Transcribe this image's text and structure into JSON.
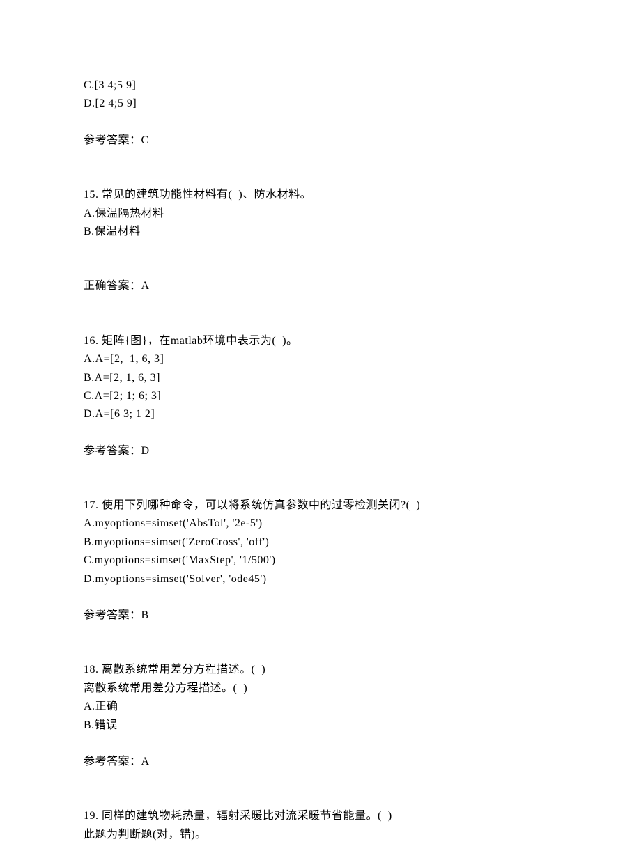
{
  "q14_partial": {
    "option_c": "C.[3 4;5 9]",
    "option_d": "D.[2 4;5 9]",
    "answer_label": "参考答案：C"
  },
  "q15": {
    "stem": "15. 常见的建筑功能性材料有(  )、防水材料。",
    "option_a": "A.保温隔热材料",
    "option_b": "B.保温材料",
    "answer_label": "正确答案：A"
  },
  "q16": {
    "stem": "16. 矩阵{图}，在matlab环境中表示为(  )。",
    "option_a": "A.A=[2,  1, 6, 3]",
    "option_b": "B.A=[2, 1, 6, 3]",
    "option_c": "C.A=[2; 1; 6; 3]",
    "option_d": "D.A=[6 3; 1 2]",
    "answer_label": "参考答案：D"
  },
  "q17": {
    "stem": "17. 使用下列哪种命令，可以将系统仿真参数中的过零检测关闭?(  )",
    "option_a": "A.myoptions=simset('AbsTol', '2e-5')",
    "option_b": "B.myoptions=simset('ZeroCross', 'off')",
    "option_c": "C.myoptions=simset('MaxStep', '1/500')",
    "option_d": "D.myoptions=simset('Solver', 'ode45')",
    "answer_label": "参考答案：B"
  },
  "q18": {
    "stem": "18. 离散系统常用差分方程描述。(  )",
    "stem_repeat": "离散系统常用差分方程描述。(  )",
    "option_a": "A.正确",
    "option_b": "B.错误",
    "answer_label": "参考答案：A"
  },
  "q19": {
    "stem": "19. 同样的建筑物耗热量，辐射采暖比对流采暖节省能量。(  )",
    "note": "此题为判断题(对，错)。"
  }
}
